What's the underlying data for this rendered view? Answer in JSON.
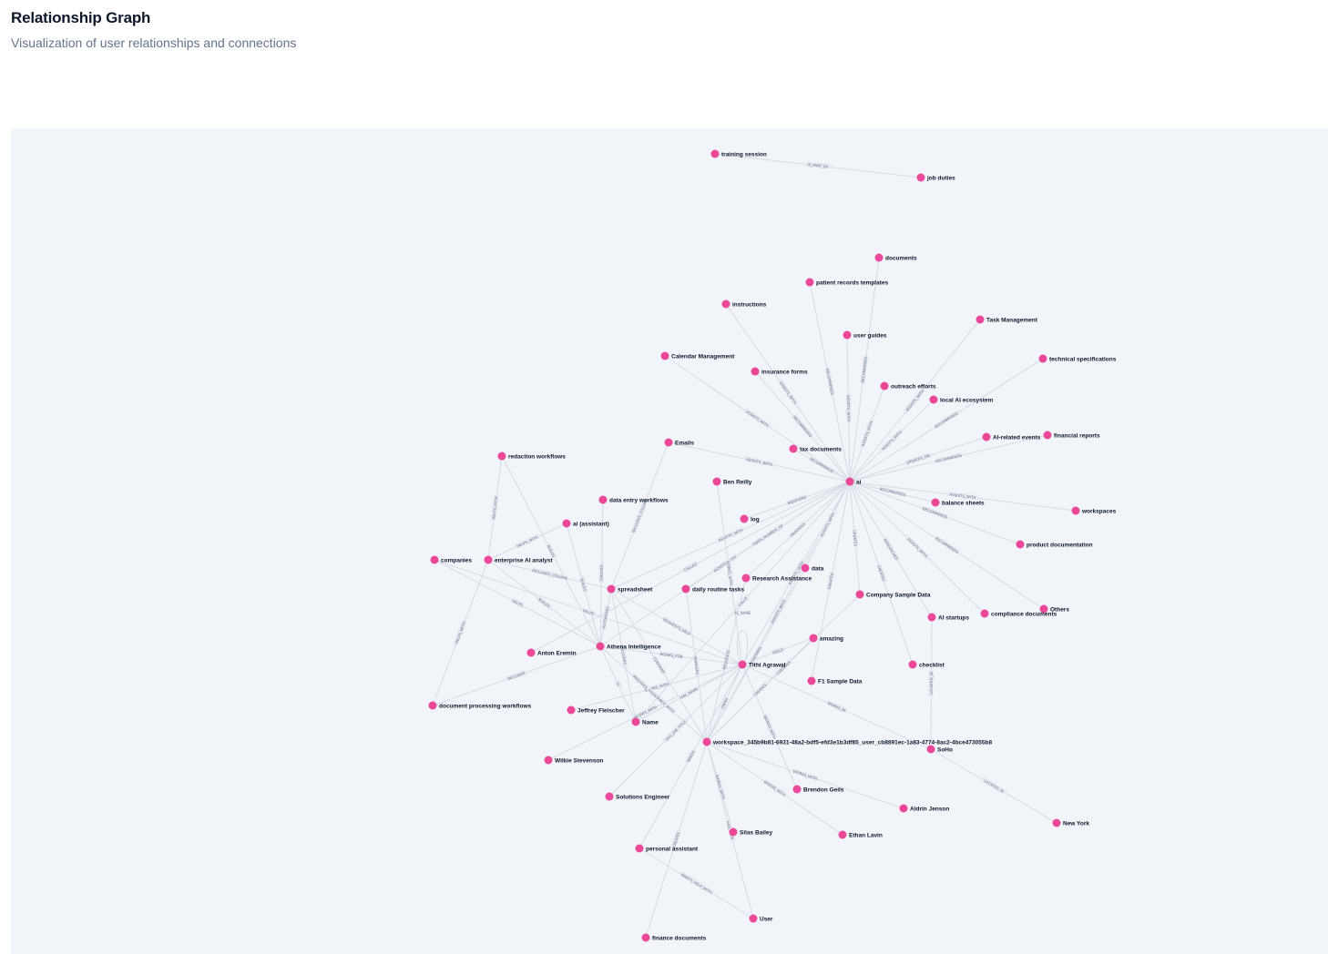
{
  "header": {
    "title": "Relationship Graph",
    "subtitle": "Visualization of user relationships and connections"
  },
  "colors": {
    "node": "#ec4899",
    "edge": "#d6dbe3",
    "panel_background": "#f1f4f8"
  },
  "graph": {
    "nodes": [
      {
        "id": "training_session",
        "label": "training session"
      },
      {
        "id": "job_duties",
        "label": "job duties"
      },
      {
        "id": "documents",
        "label": "documents"
      },
      {
        "id": "patient_records",
        "label": "patient records templates"
      },
      {
        "id": "instructions",
        "label": "instructions"
      },
      {
        "id": "task_management",
        "label": "Task Management"
      },
      {
        "id": "user_guides",
        "label": "user guides"
      },
      {
        "id": "calendar_management",
        "label": "Calendar Management"
      },
      {
        "id": "technical_specs",
        "label": "technical specifications"
      },
      {
        "id": "insurance_forms",
        "label": "insurance forms"
      },
      {
        "id": "outreach_efforts",
        "label": "outreach efforts"
      },
      {
        "id": "local_ai",
        "label": "local AI ecosystem"
      },
      {
        "id": "ai_events",
        "label": "AI-related events"
      },
      {
        "id": "financial_reports",
        "label": "financial reports"
      },
      {
        "id": "emails",
        "label": "Emails"
      },
      {
        "id": "tax_documents",
        "label": "tax documents"
      },
      {
        "id": "redaction_workflows",
        "label": "redaction workflows"
      },
      {
        "id": "ben_reilly",
        "label": "Ben Reilly"
      },
      {
        "id": "ai",
        "label": "ai"
      },
      {
        "id": "balance_sheets",
        "label": "balance sheets"
      },
      {
        "id": "data_entry_workflows",
        "label": "data entry workflows"
      },
      {
        "id": "workspaces",
        "label": "workspaces"
      },
      {
        "id": "log",
        "label": "log"
      },
      {
        "id": "ai_assistant",
        "label": "ai (assistant)"
      },
      {
        "id": "product_documentation",
        "label": "product documentation"
      },
      {
        "id": "companies",
        "label": "companies"
      },
      {
        "id": "enterprise_ai_analyst",
        "label": "enterprise AI analyst"
      },
      {
        "id": "data",
        "label": "data"
      },
      {
        "id": "research_assistance",
        "label": "Research Assistance"
      },
      {
        "id": "spreadsheet",
        "label": "spreadsheet"
      },
      {
        "id": "daily_routine_tasks",
        "label": "daily routine tasks"
      },
      {
        "id": "company_sample_data",
        "label": "Company Sample Data"
      },
      {
        "id": "others",
        "label": "Others"
      },
      {
        "id": "compliance_documents",
        "label": "compliance documents"
      },
      {
        "id": "ai_startups",
        "label": "AI startups"
      },
      {
        "id": "amazing",
        "label": "amazing"
      },
      {
        "id": "athena_intelligence",
        "label": "Athena Intelligence"
      },
      {
        "id": "anton_eremin",
        "label": "Anton Eremin"
      },
      {
        "id": "tithi_agrawal",
        "label": "Tithi Agrawal"
      },
      {
        "id": "checklist",
        "label": "checklist"
      },
      {
        "id": "f1_sample_data",
        "label": "F1 Sample Data"
      },
      {
        "id": "document_processing_workflows",
        "label": "document processing workflows"
      },
      {
        "id": "jeffrey_fleischer",
        "label": "Jeffrey Fleischer"
      },
      {
        "id": "name",
        "label": "Name"
      },
      {
        "id": "workspace",
        "label": "workspace_345b9b81-6931-48a2-bdf5-efd3e1b3df85_user_cb8891ec-1a83-4774-8ac2-4bce473055b8"
      },
      {
        "id": "soho",
        "label": "SoHo"
      },
      {
        "id": "wilkie_stevenson",
        "label": "Wilkie Stevenson"
      },
      {
        "id": "brendon_geils",
        "label": "Brendon Geils"
      },
      {
        "id": "solutions_engineer",
        "label": "Solutions Engineer"
      },
      {
        "id": "aldrin_jenson",
        "label": "Aldrin Jenson"
      },
      {
        "id": "new_york",
        "label": "New York"
      },
      {
        "id": "silas_bailey",
        "label": "Silas Bailey"
      },
      {
        "id": "ethan_lavin",
        "label": "Ethan Lavin"
      },
      {
        "id": "personal_assistant",
        "label": "personal assistant"
      },
      {
        "id": "user",
        "label": "User"
      },
      {
        "id": "finance_documents",
        "label": "finance documents"
      }
    ],
    "edges": [
      {
        "source": "training_session",
        "target": "job_duties",
        "label": "IS_PART_OF"
      },
      {
        "source": "ai",
        "target": "documents",
        "label": "RECOMMENDS"
      },
      {
        "source": "ai",
        "target": "patient_records",
        "label": "RECOMMENDS"
      },
      {
        "source": "ai",
        "target": "instructions",
        "label": "ASSISTS_WITH"
      },
      {
        "source": "ai",
        "target": "task_management",
        "label": "ASSISTS_WITH"
      },
      {
        "source": "ai",
        "target": "user_guides",
        "label": "ASSISTS_WITH"
      },
      {
        "source": "ai",
        "target": "calendar_management",
        "label": "ASSISTS_WITH"
      },
      {
        "source": "ai",
        "target": "technical_specs",
        "label": "RECOMMENDS"
      },
      {
        "source": "ai",
        "target": "insurance_forms",
        "label": "RECOMMENDS"
      },
      {
        "source": "ai",
        "target": "outreach_efforts",
        "label": "ASSISTS_WITH"
      },
      {
        "source": "ai",
        "target": "local_ai",
        "label": "ASSISTS_WITH"
      },
      {
        "source": "ai",
        "target": "ai_events",
        "label": "UPDATES_ON"
      },
      {
        "source": "ai",
        "target": "financial_reports",
        "label": "RECOMMENDS"
      },
      {
        "source": "ai",
        "target": "emails",
        "label": "ASSISTS_WITH"
      },
      {
        "source": "ai",
        "target": "tax_documents",
        "label": "RECOMMENDS"
      },
      {
        "source": "ai",
        "target": "balance_sheets",
        "label": "RECOMMENDS"
      },
      {
        "source": "ai",
        "target": "workspaces",
        "label": "ASSISTS_WITH"
      },
      {
        "source": "ai",
        "target": "log",
        "label": "MENTIONS"
      },
      {
        "source": "ai",
        "target": "product_documentation",
        "label": "RECOMMENDS"
      },
      {
        "source": "ai",
        "target": "compliance_documents",
        "label": "ASSISTS_WITH"
      },
      {
        "source": "ai",
        "target": "others",
        "label": "RECOMMENDS"
      },
      {
        "source": "ai",
        "target": "company_sample_data",
        "label": "CREATES"
      },
      {
        "source": "ai",
        "target": "ai_startups",
        "label": "RESEARCHES"
      },
      {
        "source": "ai",
        "target": "checklist",
        "label": "CREATES"
      },
      {
        "source": "ai",
        "target": "data",
        "label": "ASSISTS_WITH"
      },
      {
        "source": "ai",
        "target": "research_assistance",
        "label": "PROVIDES"
      },
      {
        "source": "ai",
        "target": "spreadsheet",
        "label": "ASSISTS_WITH"
      },
      {
        "source": "ai",
        "target": "f1_sample_data",
        "label": "CREATES"
      },
      {
        "source": "ai",
        "target": "tithi_agrawal",
        "label": "ASSISTS_WITH"
      },
      {
        "source": "ai",
        "target": "workspace",
        "label": "ASSISTS_WITH"
      },
      {
        "source": "ai",
        "target": "athena_intelligence",
        "label": "ASSISTS_WITH"
      },
      {
        "source": "ai",
        "target": "daily_routine_tasks",
        "label": "TAKES_NUMBER_OF"
      },
      {
        "source": "ai",
        "target": "name",
        "label": "CALLS"
      },
      {
        "source": "ai",
        "target": "anton_eremin",
        "label": "CALLED"
      },
      {
        "source": "tithi_agrawal",
        "target": "ben_reilly",
        "label": "WORKS_WITH"
      },
      {
        "source": "tithi_agrawal",
        "target": "tithi_agrawal",
        "label": "IS_NAME"
      },
      {
        "source": "tithi_agrawal",
        "target": "amazing",
        "label": "FEELS"
      },
      {
        "source": "tithi_agrawal",
        "target": "spreadsheet",
        "label": "REQUESTS_HELP"
      },
      {
        "source": "tithi_agrawal",
        "target": "athena_intelligence",
        "label": "WORKS_FOR"
      },
      {
        "source": "tithi_agrawal",
        "target": "name",
        "label": "HAS_NAME"
      },
      {
        "source": "tithi_agrawal",
        "target": "jeffrey_fleischer",
        "label": "WORKS_WITH"
      },
      {
        "source": "tithi_agrawal",
        "target": "wilkie_stevenson",
        "label": "WORKS_WITH"
      },
      {
        "source": "tithi_agrawal",
        "target": "solutions_engineer",
        "label": "HAS_JOB_TITLE"
      },
      {
        "source": "tithi_agrawal",
        "target": "workspace",
        "label": "OWNS"
      },
      {
        "source": "tithi_agrawal",
        "target": "brendon_geils",
        "label": "WORKS_WITH"
      },
      {
        "source": "tithi_agrawal",
        "target": "soho",
        "label": "WORKS_IN"
      },
      {
        "source": "tithi_agrawal",
        "target": "personal_assistant",
        "label": "NEEDS"
      },
      {
        "source": "tithi_agrawal",
        "target": "companies",
        "label": "HELPS"
      },
      {
        "source": "athena_intelligence",
        "target": "redaction_workflows",
        "label": "BUILDS"
      },
      {
        "source": "athena_intelligence",
        "target": "data_entry_workflows",
        "label": "CREATES"
      },
      {
        "source": "athena_intelligence",
        "target": "ai_assistant",
        "label": "BUILDS"
      },
      {
        "source": "athena_intelligence",
        "target": "enterprise_ai_analyst",
        "label": "BUILDS"
      },
      {
        "source": "athena_intelligence",
        "target": "companies",
        "label": "HELPS"
      },
      {
        "source": "athena_intelligence",
        "target": "document_processing_workflows",
        "label": "INCLUDES"
      },
      {
        "source": "athena_intelligence",
        "target": "spreadsheet",
        "label": "AUTOMATES"
      },
      {
        "source": "athena_intelligence",
        "target": "workspace",
        "label": "PROVIDES_ASSISTANCE_WITH"
      },
      {
        "source": "athena_intelligence",
        "target": "name",
        "label": "IS"
      },
      {
        "source": "enterprise_ai_analyst",
        "target": "redaction_workflows",
        "label": "HELPS_WITH"
      },
      {
        "source": "enterprise_ai_analyst",
        "target": "ai_assistant",
        "label": "HELPS_WITH"
      },
      {
        "source": "enterprise_ai_analyst",
        "target": "spreadsheet",
        "label": "INCLUDES_COLUMN"
      },
      {
        "source": "enterprise_ai_analyst",
        "target": "document_processing_workflows",
        "label": "HELPS_WITH"
      },
      {
        "source": "spreadsheet",
        "target": "emails",
        "label": "INCLUDES_COLUMN"
      },
      {
        "source": "spreadsheet",
        "target": "name",
        "label": "INCLUDES"
      },
      {
        "source": "spreadsheet",
        "target": "workspace",
        "label": "CONTAINS"
      },
      {
        "source": "workspace",
        "target": "daily_routine_tasks",
        "label": "MANAGES"
      },
      {
        "source": "workspace",
        "target": "data",
        "label": "CONTAINS"
      },
      {
        "source": "workspace",
        "target": "research_assistance",
        "label": "REQUESTS"
      },
      {
        "source": "workspace",
        "target": "amazing",
        "label": "CREATES"
      },
      {
        "source": "workspace",
        "target": "aldrin_jenson",
        "label": "WORKS_WITH"
      },
      {
        "source": "workspace",
        "target": "ethan_lavin",
        "label": "WORKS_WITH"
      },
      {
        "source": "workspace",
        "target": "silas_bailey",
        "label": "WORKS_WITH"
      },
      {
        "source": "workspace",
        "target": "finance_documents",
        "label": "CREATES"
      },
      {
        "source": "workspace",
        "target": "user",
        "label": "HAS_USER"
      },
      {
        "source": "workspace",
        "target": "company_sample_data",
        "label": "CONTAINS"
      },
      {
        "source": "personal_assistant",
        "target": "user",
        "label": "WANTS_HELP_WITH"
      },
      {
        "source": "ai_startups",
        "target": "soho",
        "label": "LOCATED_IN"
      },
      {
        "source": "soho",
        "target": "new_york",
        "label": "LOCATED_IN"
      }
    ]
  }
}
